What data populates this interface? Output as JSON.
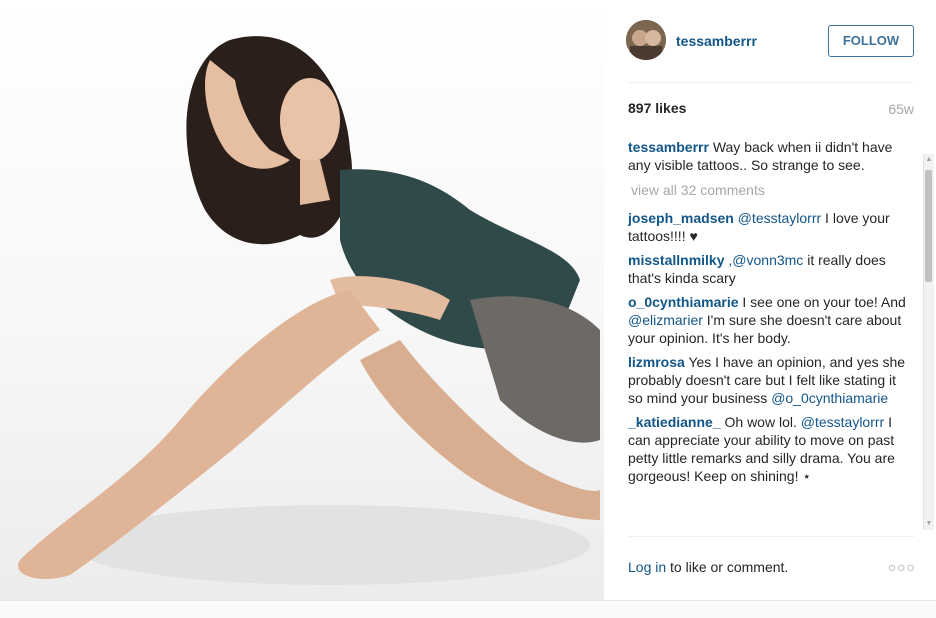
{
  "post": {
    "username": "tessamberrr",
    "follow_label": "FOLLOW",
    "likes": "897 likes",
    "age": "65w",
    "caption": {
      "user": "tessamberrr",
      "text": "Way back when ii didn't have any visible tattoos.. So strange to see."
    },
    "view_all": "view all 32 comments",
    "comments": [
      {
        "user": "joseph_madsen",
        "mention": "@tesstaylorrr",
        "text": " I love your tattoos!!!! ♥"
      },
      {
        "user": "misstallnmilky",
        "mention": ",@vonn3mc",
        "text": " it really does that's kinda scary"
      },
      {
        "user": "o_0cynthiamarie",
        "text_before": " I see one on your toe! And ",
        "mention": "@elizmarier",
        "text": " I'm sure she doesn't care about your opinion. It's her body."
      },
      {
        "user": "lizmrosa",
        "text_before": " Yes I have an opinion, and yes she probably doesn't care but I felt like stating it so mind your business ",
        "mention": "@o_0cynthiamarie",
        "text": ""
      },
      {
        "user": "_katiedianne_",
        "text_before": " Oh wow lol. ",
        "mention": "@tesstaylorrr",
        "text": " I can appreciate your ability to move on past petty little remarks and silly drama. You are gorgeous! Keep on shining! ⋆"
      }
    ],
    "footer": {
      "login": "Log in",
      "rest": " to like or comment.",
      "more": "○○○"
    }
  },
  "icons": {
    "more": "more-options-icon"
  },
  "colors": {
    "link": "#125688",
    "follow": "#3f729b",
    "muted": "#a5a7aa"
  }
}
